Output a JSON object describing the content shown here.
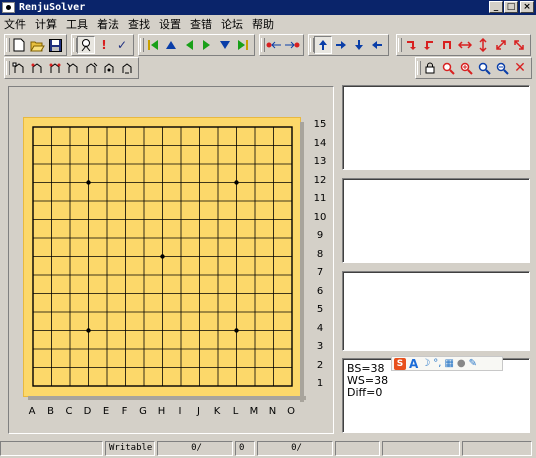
{
  "window": {
    "title": "RenjuSolver"
  },
  "titlebar_buttons": {
    "minimize": "_",
    "maximize": "□",
    "close": "×"
  },
  "menu": [
    "文件",
    "计算",
    "工具",
    "着法",
    "查找",
    "设置",
    "查错",
    "论坛",
    "帮助"
  ],
  "toolbar1": {
    "file_group": [
      "new-icon",
      "open-icon",
      "save-icon"
    ],
    "analysis_group": [
      "analyze-icon",
      "exclamation-icon",
      "checkmark-icon"
    ],
    "navigation_group": [
      "first-move-icon",
      "up-triangle-icon",
      "previous-move-icon",
      "next-move-icon",
      "down-triangle-icon",
      "last-move-icon"
    ],
    "stone_group": [
      "stone-left-icon",
      "stone-right-icon"
    ],
    "shift_group": [
      "shift-up-icon",
      "shift-right-icon",
      "shift-down-icon",
      "shift-left-icon"
    ],
    "transform_group": [
      "rotate-right-icon",
      "rotate-left-icon",
      "rotate-180-icon",
      "flip-horizontal-icon",
      "flip-vertical-icon",
      "flip-diagonal-icon",
      "flip-antidiagonal-icon"
    ]
  },
  "toolbar2": {
    "tool_group": [
      "tool-1-icon",
      "tool-2-icon",
      "tool-3-icon",
      "tool-4-icon",
      "tool-5-icon",
      "tool-6-icon",
      "tool-7-icon"
    ],
    "view_group": [
      "lock-icon",
      "zoom-icon",
      "zoom-in-icon",
      "zoom-out-icon",
      "zoom-fit-icon",
      "close-icon"
    ]
  },
  "board": {
    "size": 15,
    "columns": [
      "A",
      "B",
      "C",
      "D",
      "E",
      "F",
      "G",
      "H",
      "I",
      "J",
      "K",
      "L",
      "M",
      "N",
      "O"
    ],
    "rows": [
      "15",
      "14",
      "13",
      "12",
      "11",
      "10",
      "9",
      "8",
      "7",
      "6",
      "5",
      "4",
      "3",
      "2",
      "1"
    ],
    "star_points": [
      "D12",
      "L12",
      "H8",
      "D4",
      "L4"
    ]
  },
  "info_panel": {
    "lines": [
      "BS=38",
      "WS=38",
      "Diff=0"
    ]
  },
  "ime_toolbar": {
    "logo": "S",
    "mode": "A"
  },
  "statusbar": [
    "",
    "Writable",
    "0/",
    "0",
    "0/",
    "",
    "",
    ""
  ],
  "colors": {
    "board": "#fcd86a",
    "titlebar": "#0a246a",
    "chrome": "#d4d0c8",
    "red_icon": "#d82020",
    "blue_icon": "#0a3ea8",
    "green_icon": "#18a018"
  }
}
